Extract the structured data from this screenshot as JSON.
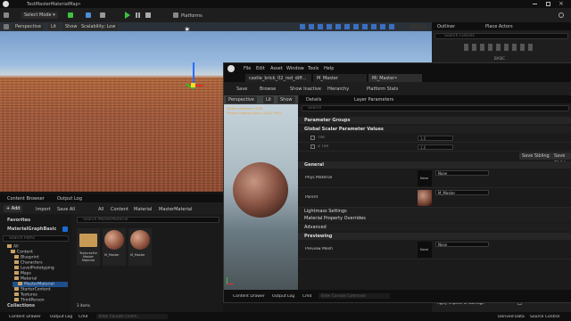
{
  "window": {
    "title": "TestMasterMaterialMap•"
  },
  "main_toolbar": {
    "select_mode": "Select Mode",
    "platforms": "Platforms"
  },
  "viewport": {
    "perspective": "Perspective",
    "lit": "Lit",
    "show": "Show",
    "scalability": "Scalability: Low"
  },
  "outliner": {
    "tab": "Outliner",
    "place_actors": "Place Actors",
    "search_placeholder": "Search Classes",
    "basic": "BASIC"
  },
  "content_browser": {
    "tab": "Content Browser",
    "output_log": "Output Log",
    "add": "Add",
    "import": "Import",
    "save_all": "Save All",
    "breadcrumb": [
      "All",
      "Content",
      "Material",
      "MasterMaterial"
    ],
    "favorites": "Favorites",
    "project": "MaterialGraphBasic",
    "search_paths": "Search Paths",
    "search_assets": "Search MasterMaterial",
    "tree": [
      "All",
      "Content",
      "Blueprint",
      "Characters",
      "LevelPrototyping",
      "Maps",
      "Material",
      "MasterMaterial",
      "StarterContent",
      "Textures",
      "ThirdPerson"
    ],
    "assets": [
      {
        "label": "TexturesFor\nMaster\nMaterial",
        "kind": "folder"
      },
      {
        "label": "M_Master",
        "kind": "sphere"
      },
      {
        "label": "M_Master",
        "kind": "sphere"
      }
    ],
    "count": "3 items",
    "collections": "Collections"
  },
  "material_editor": {
    "menu": [
      "File",
      "Edit",
      "Asset",
      "Window",
      "Tools",
      "Help"
    ],
    "tabs": [
      "castle_brick_02_red_diff...",
      "M_Master",
      "Mi_Master•"
    ],
    "toolbar": [
      "Save",
      "Browse",
      "Show Inactive",
      "Hierarchy",
      "Platform Stats"
    ],
    "preview": {
      "perspective": "Perspective",
      "lit": "Lit",
      "show": "Show",
      "stats_line1": "Texture samplers: 5/16",
      "stats_line2": "Texture Lookups (Est.): VS(0), PS(1)"
    },
    "details_tab": "Details",
    "layer_tab": "Layer Parameters",
    "search_placeholder": "Search",
    "sections": {
      "param_groups": "Parameter Groups",
      "global_scalar": "Global Scalar Parameter Values",
      "general": "General",
      "lightmass": "Lightmass Settings",
      "mat_overrides": "Material Property Overrides",
      "advanced": "Advanced",
      "previewing": "Previewing"
    },
    "params": [
      {
        "label": "Tile",
        "value": "1.0"
      },
      {
        "label": "2 Tile",
        "value": "1.0"
      }
    ],
    "save_sibling": "Save Sibling",
    "save_child": "Save Child",
    "phys_material": "Phys Material",
    "none": "None",
    "parent": "Parent",
    "parent_value": "M_Master",
    "preview_mesh": "Preview Mesh",
    "bottom": {
      "content_drawer": "Content Drawer",
      "output_log": "Output Log",
      "cmd": "Cmd",
      "cmd_placeholder": "Enter Console Command"
    }
  },
  "right_panel": {
    "apply_impulse": "Apply Impulse on Damage",
    "source_control": "Source Control",
    "derived": "Derived Data"
  },
  "status": {
    "content_drawer": "Content Drawer",
    "output_log": "Output Log",
    "cmd": "Cmd",
    "cmd_placeholder": "Enter Console Comm..."
  },
  "colors": {
    "accent": "#0070e0",
    "ue_blue": "#1a6dd4",
    "green": "#3ec33e"
  }
}
